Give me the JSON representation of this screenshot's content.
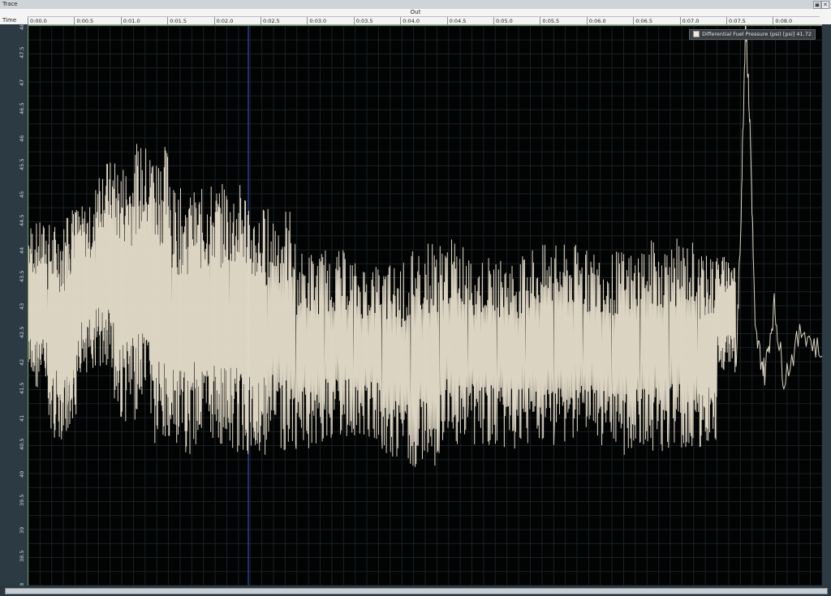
{
  "window": {
    "title": "Trace"
  },
  "top_axis": {
    "label": "Out",
    "time_label": "Time",
    "tick_labels": [
      "0:00.0",
      "0:00.5",
      "0:01.0",
      "0:01.5",
      "0:02.0",
      "0:02.5",
      "0:03.0",
      "0:03.5",
      "0:04.0",
      "0:04.5",
      "0:05.0",
      "0:05.5",
      "0:06.0",
      "0:06.5",
      "0:07.0",
      "0:07.5",
      "0:08.0"
    ]
  },
  "legend": {
    "label": "Differential Fuel Pressure (psi) [psi]",
    "value": "41.72"
  },
  "colors": {
    "trace": "#efe6d2",
    "cursor": "#3b5ed6",
    "grid": "#1b2124",
    "frame": "#6d9a55"
  },
  "chart_data": {
    "type": "line",
    "series": [
      {
        "name": "Differential Fuel Pressure (psi) [psi]",
        "x": [
          0.0,
          0.2,
          0.4,
          0.5,
          0.7,
          0.9,
          1.1,
          1.3,
          1.5,
          1.7,
          1.9,
          2.1,
          2.3,
          2.5,
          2.8,
          3.1,
          3.4,
          3.7,
          4.0,
          4.3,
          4.6,
          4.9,
          5.2,
          5.5,
          5.8,
          6.1,
          6.4,
          6.7,
          7.0,
          7.2,
          7.4,
          7.45,
          7.5,
          7.55,
          7.6,
          7.7,
          7.8,
          7.9,
          8.1,
          8.3
        ],
        "y": [
          41.5,
          44.5,
          40.6,
          44.8,
          41.8,
          45.6,
          40.9,
          45.9,
          40.3,
          45.1,
          40.5,
          45.2,
          40.3,
          44.8,
          40.4,
          44.0,
          40.6,
          43.8,
          40.1,
          44.2,
          40.5,
          43.9,
          40.4,
          44.1,
          40.5,
          44.0,
          40.3,
          44.2,
          40.4,
          43.9,
          41.8,
          44.5,
          48.2,
          46.0,
          42.5,
          41.8,
          43.0,
          41.7,
          42.6,
          42.1
        ]
      }
    ],
    "xlabel": "Time",
    "ylabel": "",
    "xlim": [
      0.0,
      8.3
    ],
    "ylim": [
      38.0,
      48.0
    ],
    "yticks": [
      "38",
      "38.5",
      "39",
      "39.5",
      "40",
      "40.5",
      "41",
      "41.5",
      "42",
      "42.5",
      "43",
      "43.5",
      "44",
      "44.5",
      "45",
      "45.5",
      "46",
      "46.5",
      "47",
      "47.5",
      "48"
    ],
    "cursor_x": 2.3,
    "grid": true,
    "legend_position": "top-right"
  }
}
